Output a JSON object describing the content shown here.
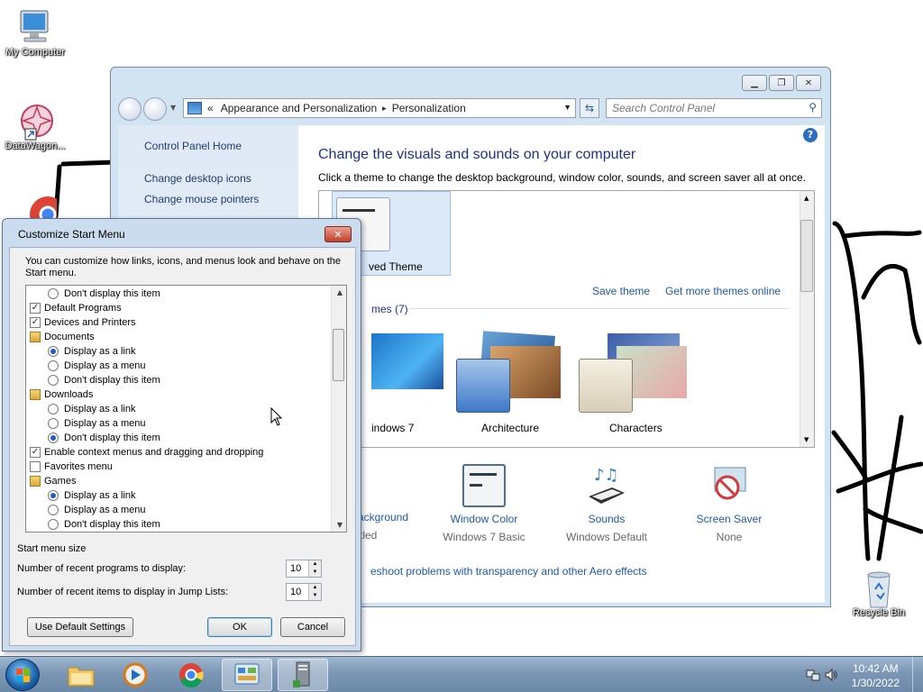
{
  "desktop": {
    "icons": [
      {
        "label": "My Computer"
      },
      {
        "label": "DataWagon..."
      },
      {
        "label": "Recycle Bin"
      }
    ]
  },
  "control_panel": {
    "breadcrumb_prefix": "«",
    "breadcrumb_1": "Appearance and Personalization",
    "breadcrumb_sep": "▸",
    "breadcrumb_2": "Personalization",
    "search_placeholder": "Search Control Panel",
    "left_links": [
      "Control Panel Home",
      "Change desktop icons",
      "Change mouse pointers"
    ],
    "heading": "Change the visuals and sounds on your computer",
    "subheading": "Click a theme to change the desktop background, window color, sounds, and screen saver all at once.",
    "saved_theme_label": "ved Theme",
    "save_theme": "Save theme",
    "get_more_themes": "Get more themes online",
    "group_label": "mes (7)",
    "themes": [
      "indows 7",
      "Architecture",
      "Characters"
    ],
    "bottom_items": [
      {
        "name": "Background",
        "value": "titled"
      },
      {
        "name": "Window Color",
        "value": "Windows 7 Basic"
      },
      {
        "name": "Sounds",
        "value": "Windows Default"
      },
      {
        "name": "Screen Saver",
        "value": "None"
      }
    ],
    "troubleshoot": "eshoot problems with transparency and other Aero effects"
  },
  "dialog": {
    "title": "Customize Start Menu",
    "close_glyph": "✕",
    "intro": "You can customize how links, icons, and menus look and behave on the Start menu.",
    "items": [
      {
        "kind": "radio",
        "indent": 1,
        "label": "Don't display this item",
        "checked": false
      },
      {
        "kind": "check",
        "indent": 0,
        "label": "Default Programs",
        "checked": true
      },
      {
        "kind": "check",
        "indent": 0,
        "label": "Devices and Printers",
        "checked": true
      },
      {
        "kind": "icon",
        "indent": 0,
        "label": "Documents"
      },
      {
        "kind": "radio",
        "indent": 1,
        "label": "Display as a link",
        "checked": true
      },
      {
        "kind": "radio",
        "indent": 1,
        "label": "Display as a menu",
        "checked": false
      },
      {
        "kind": "radio",
        "indent": 1,
        "label": "Don't display this item",
        "checked": false
      },
      {
        "kind": "icon",
        "indent": 0,
        "label": "Downloads"
      },
      {
        "kind": "radio",
        "indent": 1,
        "label": "Display as a link",
        "checked": false
      },
      {
        "kind": "radio",
        "indent": 1,
        "label": "Display as a menu",
        "checked": false
      },
      {
        "kind": "radio",
        "indent": 1,
        "label": "Don't display this item",
        "checked": true
      },
      {
        "kind": "check",
        "indent": 0,
        "label": "Enable context menus and dragging and dropping",
        "checked": true
      },
      {
        "kind": "check",
        "indent": 0,
        "label": "Favorites menu",
        "checked": false
      },
      {
        "kind": "icon",
        "indent": 0,
        "label": "Games"
      },
      {
        "kind": "radio",
        "indent": 1,
        "label": "Display as a link",
        "checked": true
      },
      {
        "kind": "radio",
        "indent": 1,
        "label": "Display as a menu",
        "checked": false
      },
      {
        "kind": "radio",
        "indent": 1,
        "label": "Don't display this item",
        "checked": false
      }
    ],
    "size_group_title": "Start menu size",
    "recent_programs_label": "Number of recent programs to display:",
    "recent_programs_value": "10",
    "recent_items_label": "Number of recent items to display in Jump Lists:",
    "recent_items_value": "10",
    "default_settings_btn": "Use Default Settings",
    "ok_btn": "OK",
    "cancel_btn": "Cancel"
  },
  "taskbar": {
    "time": "10:42 AM",
    "date": "1/30/2022"
  },
  "colors": {
    "link": "#1e5aa8",
    "heading": "#1e3287",
    "taskbar": "#7b97b5"
  }
}
